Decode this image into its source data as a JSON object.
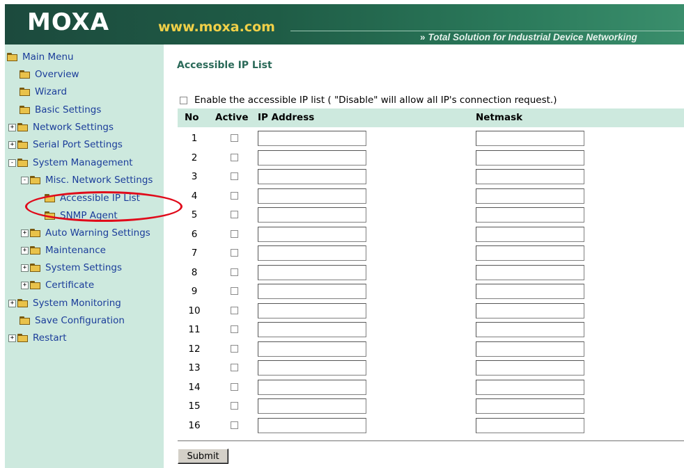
{
  "header": {
    "logo": "MOXA",
    "url": "www.moxa.com",
    "tagline": "Total Solution for Industrial Device Networking",
    "tagline_icon": "double-chevron-right",
    "colors": {
      "banner": "#1f5c46",
      "url": "#f0d048"
    }
  },
  "sidebar": {
    "items": [
      {
        "label": "Main Menu"
      },
      {
        "label": "Overview"
      },
      {
        "label": "Wizard"
      },
      {
        "label": "Basic Settings"
      },
      {
        "label": "Network Settings"
      },
      {
        "label": "Serial Port Settings"
      },
      {
        "label": "System Management"
      },
      {
        "label": "Misc. Network Settings"
      },
      {
        "label": "Accessible IP List"
      },
      {
        "label": "SNMP Agent"
      },
      {
        "label": "Auto Warning Settings"
      },
      {
        "label": "Maintenance"
      },
      {
        "label": "System Settings"
      },
      {
        "label": "Certificate"
      },
      {
        "label": "System Monitoring"
      },
      {
        "label": "Save Configuration"
      },
      {
        "label": "Restart"
      }
    ],
    "expander_plus": "+",
    "expander_minus": "-"
  },
  "main": {
    "title": "Accessible IP List",
    "enable_label": "Enable the accessible IP list ( \"Disable\" will allow all IP's connection request.)",
    "columns": {
      "no": "No",
      "active": "Active",
      "ip": "IP Address",
      "netmask": "Netmask"
    },
    "rows": [
      {
        "no": "1"
      },
      {
        "no": "2"
      },
      {
        "no": "3"
      },
      {
        "no": "4"
      },
      {
        "no": "5"
      },
      {
        "no": "6"
      },
      {
        "no": "7"
      },
      {
        "no": "8"
      },
      {
        "no": "9"
      },
      {
        "no": "10"
      },
      {
        "no": "11"
      },
      {
        "no": "12"
      },
      {
        "no": "13"
      },
      {
        "no": "14"
      },
      {
        "no": "15"
      },
      {
        "no": "16"
      }
    ],
    "submit_label": "Submit",
    "highlight_color": "#e00a1a"
  }
}
